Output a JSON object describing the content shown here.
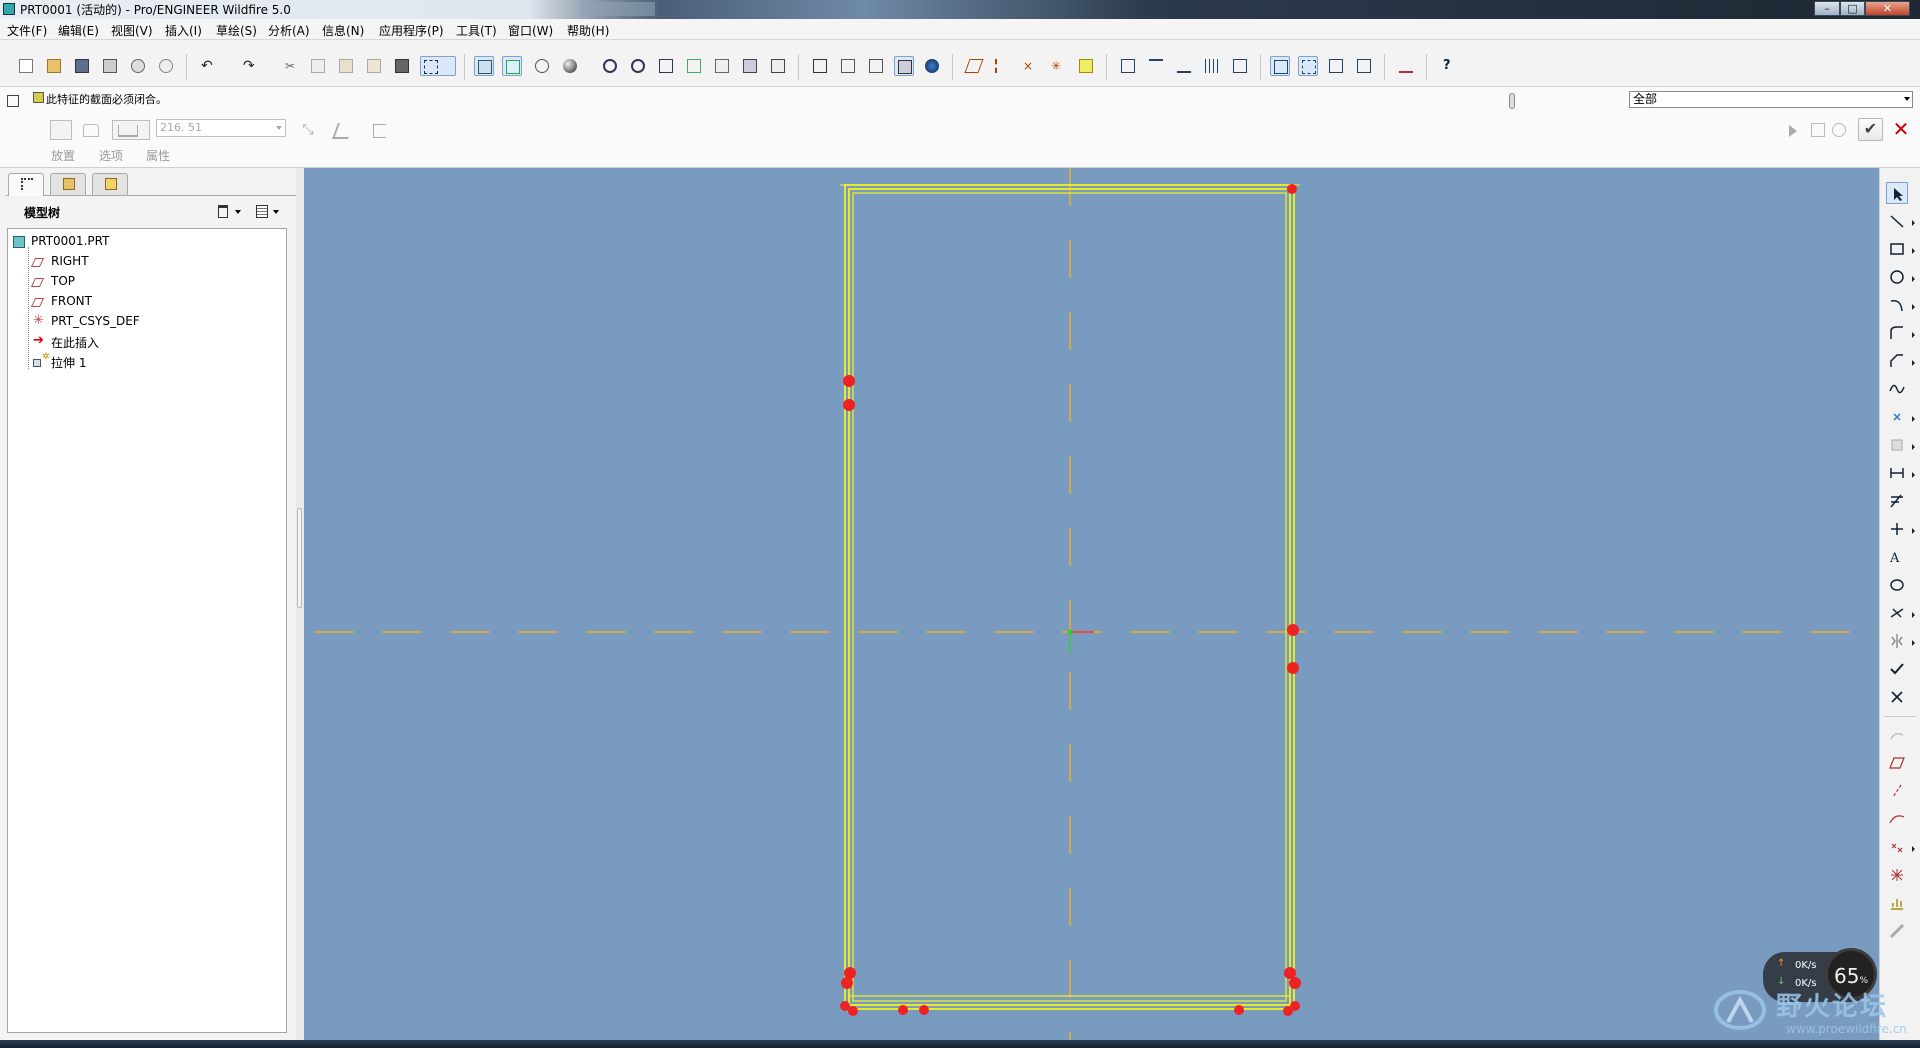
{
  "window": {
    "title": "PRT0001 (活动的) - Pro/ENGINEER Wildfire 5.0",
    "controls": [
      "minimize",
      "maximize",
      "close"
    ]
  },
  "menu": [
    "文件(F)",
    "编辑(E)",
    "视图(V)",
    "插入(I)",
    "草绘(S)",
    "分析(A)",
    "信息(N)",
    "应用程序(P)",
    "工具(T)",
    "窗口(W)",
    "帮助(H)"
  ],
  "message": {
    "text": "此特征的截面必须闭合。",
    "filter_value": "全部"
  },
  "dashboard": {
    "depth_value": "216. 51",
    "tabs": [
      "放置",
      "选项",
      "属性"
    ]
  },
  "navigator": {
    "title": "模型树",
    "tree": [
      {
        "label": "PRT0001.PRT",
        "icon": "part-icon"
      },
      {
        "label": "RIGHT",
        "icon": "datum-plane-icon"
      },
      {
        "label": "TOP",
        "icon": "datum-plane-icon"
      },
      {
        "label": "FRONT",
        "icon": "datum-plane-icon"
      },
      {
        "label": "PRT_CSYS_DEF",
        "icon": "csys-icon"
      },
      {
        "label": "在此插入",
        "icon": "insert-here-arrow-icon"
      },
      {
        "label": "拉伸 1",
        "icon": "extrude-icon"
      }
    ]
  },
  "netmeter": {
    "up": "0K/s",
    "down": "0K/s",
    "percent": "65",
    "percent_unit": "%"
  },
  "watermark": {
    "text": "野火论坛",
    "url": "www.proewildfire.cn"
  },
  "colors": {
    "viewport_bg": "#7a9bc0",
    "sketch_line": "#f2f21a",
    "centerline": "#d4a84a",
    "endpoint": "#ee2222"
  }
}
